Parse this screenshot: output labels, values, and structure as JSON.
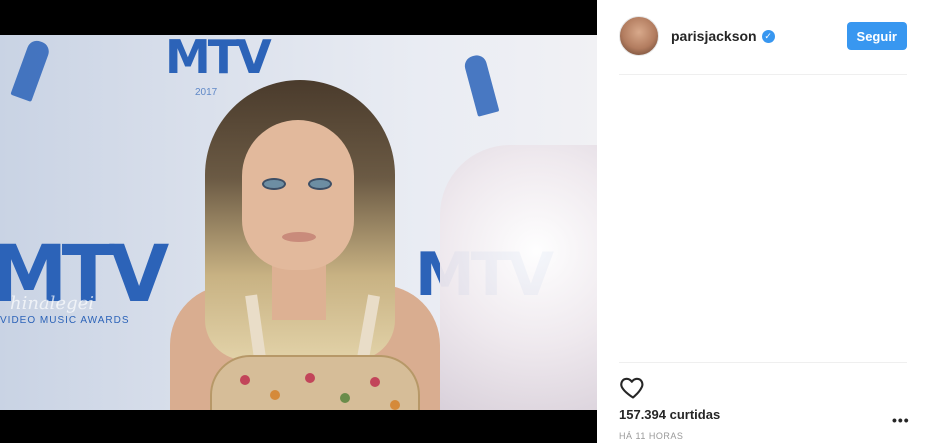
{
  "post": {
    "username": "parisjackson",
    "follow_label": "Seguir",
    "likes_text": "157.394 curtidas",
    "timestamp": "HÁ 11 HORAS"
  },
  "photo": {
    "watermark": "hinalegei",
    "backdrop_text": "VIDEO MUSIC AWARDS",
    "backdrop_year": "2017",
    "backdrop_logo": "MTV"
  },
  "icons": {
    "verified": "verified-badge-icon",
    "like": "heart-icon",
    "more": "more-options-icon"
  },
  "colors": {
    "accent": "#3897f0",
    "backdrop_blue": "#2c63b8"
  }
}
